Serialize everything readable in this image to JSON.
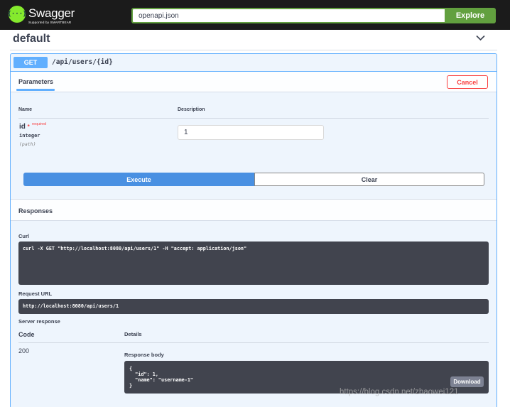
{
  "topbar": {
    "brand_title": "Swagger",
    "brand_subtitle": "Supported by SMARTBEAR",
    "logo_glyph": "{···}",
    "spec_url_value": "openapi.json",
    "explore_label": "Explore",
    "brand_color": "#85ea2d",
    "explore_color": "#62a03f"
  },
  "tag": {
    "title": "default",
    "chevron_icon": "chevron-down-icon"
  },
  "operation": {
    "method": "GET",
    "path": "/api/users/{id}",
    "method_color": "#61affe",
    "parameters_tab": "Parameters",
    "cancel_label": "Cancel",
    "columns": {
      "name": "Name",
      "description": "Description"
    },
    "param": {
      "name": "id",
      "star": "*",
      "required": "required",
      "type": "integer",
      "in": "(path)",
      "value": "1"
    },
    "execute_label": "Execute",
    "clear_label": "Clear"
  },
  "responses": {
    "title": "Responses",
    "curl_label": "Curl",
    "curl_command": "curl -X GET \"http://localhost:8080/api/users/1\" -H \"accept: application/json\"",
    "request_url_label": "Request URL",
    "request_url": "http://localhost:8080/api/users/1",
    "server_response_label": "Server response",
    "code_header": "Code",
    "details_header": "Details",
    "status_code": "200",
    "response_body_label": "Response body",
    "response_body": "{\n  \"id\": 1,\n  \"name\": \"username-1\"\n}",
    "download_label": "Download"
  },
  "watermark": "https://blog.csdn.net/zhaowei121"
}
